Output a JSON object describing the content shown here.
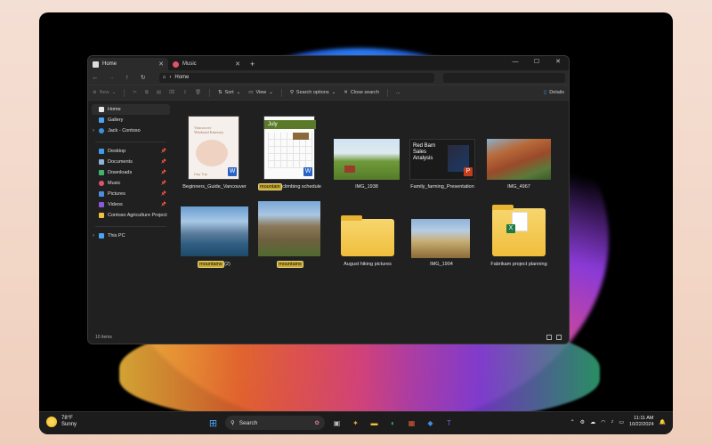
{
  "tabs": [
    {
      "label": "Home",
      "active": true
    },
    {
      "label": "Music",
      "active": false
    }
  ],
  "address": {
    "path": "Home"
  },
  "toolbar": {
    "new_label": "New",
    "sort_label": "Sort",
    "view_label": "View",
    "search_options_label": "Search options",
    "close_search_label": "Close search",
    "more_label": "...",
    "details_label": "Details"
  },
  "sidebar": {
    "top": [
      {
        "label": "Home",
        "icon": "home-icon",
        "color": "#e8e8e8"
      },
      {
        "label": "Gallery",
        "icon": "gallery-icon",
        "color": "#4aa3f0"
      },
      {
        "label": "Jack - Contoso",
        "icon": "cloud-icon",
        "color": "#3b8fe0"
      }
    ],
    "quick": [
      {
        "label": "Desktop",
        "icon": "desktop-icon",
        "color": "#3d9be9"
      },
      {
        "label": "Documents",
        "icon": "documents-icon",
        "color": "#8fb4d9"
      },
      {
        "label": "Downloads",
        "icon": "downloads-icon",
        "color": "#3fb56b"
      },
      {
        "label": "Music",
        "icon": "music-icon",
        "color": "#e0536a"
      },
      {
        "label": "Pictures",
        "icon": "pictures-icon",
        "color": "#4a8fe0"
      },
      {
        "label": "Videos",
        "icon": "videos-icon",
        "color": "#8a5ad8"
      },
      {
        "label": "Contoso Agriculture Project",
        "icon": "folder-icon",
        "color": "#f0c040"
      }
    ],
    "bottom": [
      {
        "label": "This PC",
        "icon": "pc-icon",
        "color": "#4aa3f0"
      }
    ]
  },
  "files": {
    "f1": {
      "label": "Beginners_Guide_Vancouver",
      "doc_title": "Vancouver Weekend Itinerary",
      "doc_footer": "Day Trip"
    },
    "f2": {
      "label_hl": "mountain",
      "label_rest": " climbing schedule",
      "doc_title": "July"
    },
    "f3": {
      "label": "IMG_1938"
    },
    "f4": {
      "label": "Family_farming_Presentation",
      "doc_title": "Red Barn Sales Analysis"
    },
    "f5": {
      "label": "IMG_4967"
    },
    "f6": {
      "label_hl": "mountains",
      "label_rest": " (2)"
    },
    "f7": {
      "label_hl": "mountains",
      "label_rest": ""
    },
    "f8": {
      "label": "August hiking pictures"
    },
    "f9": {
      "label": "IMG_1904"
    },
    "f10": {
      "label": "Fabrikam project planning"
    }
  },
  "status": {
    "items": "10 items"
  },
  "taskbar": {
    "temp": "78°F",
    "condition": "Sunny",
    "search_label": "Search",
    "time": "11:11 AM",
    "date": "10/22/2024"
  }
}
